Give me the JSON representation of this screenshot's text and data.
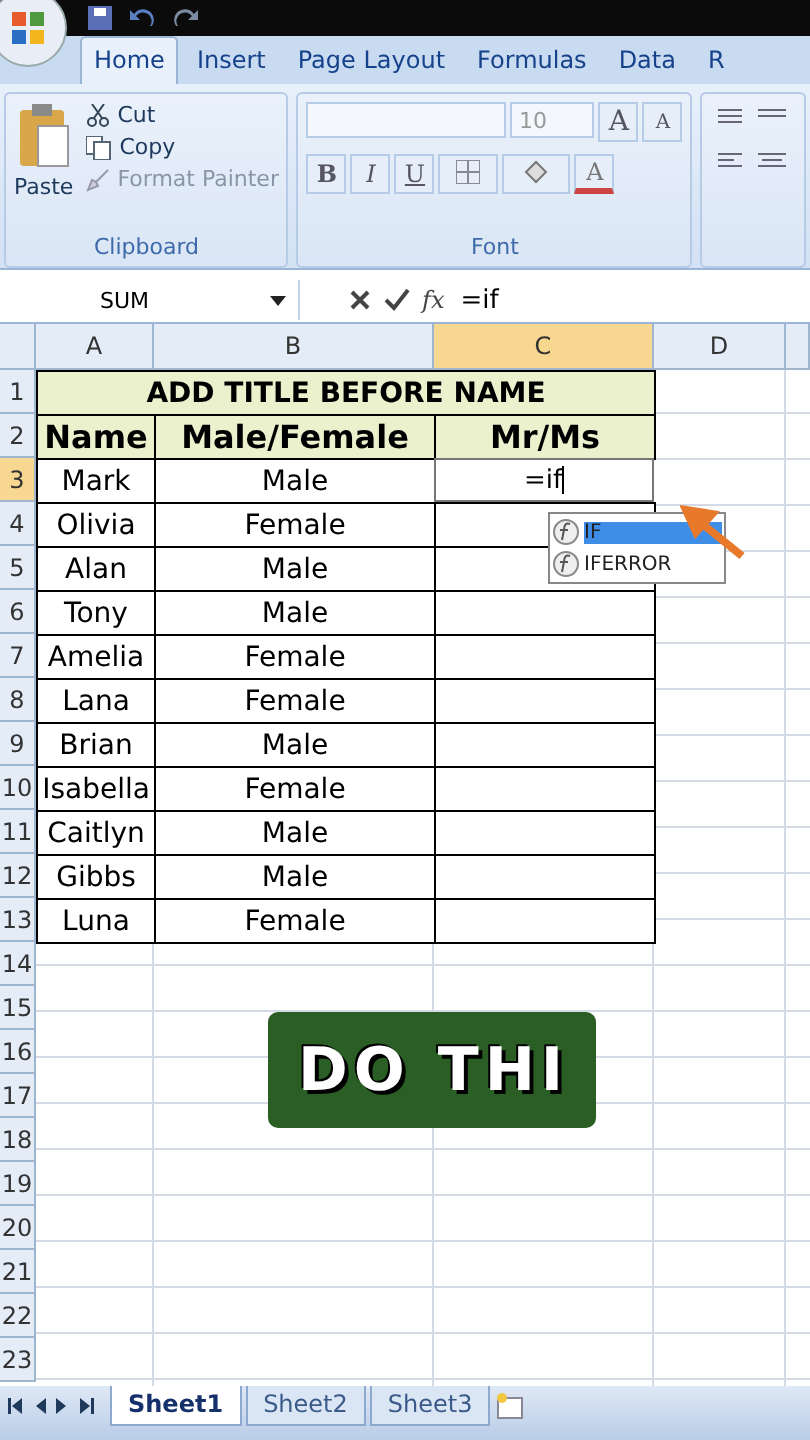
{
  "ribbon_tabs": [
    {
      "label": "Home",
      "selected": true
    },
    {
      "label": "Insert",
      "selected": false
    },
    {
      "label": "Page Layout",
      "selected": false
    },
    {
      "label": "Formulas",
      "selected": false
    },
    {
      "label": "Data",
      "selected": false
    },
    {
      "label": "R",
      "selected": false
    }
  ],
  "clipboard": {
    "paste": "Paste",
    "cut": "Cut",
    "copy": "Copy",
    "format_painter": "Format Painter",
    "group_label": "Clipboard"
  },
  "font": {
    "font_size": "10",
    "size_buttons": [
      "A",
      "A"
    ],
    "format_buttons": [
      "B",
      "I",
      "U"
    ],
    "font_color": "A",
    "group_label": "Font"
  },
  "formula_bar": {
    "name_box": "SUM",
    "function_label": "fx",
    "formula": "=if"
  },
  "columns": [
    {
      "label": "A",
      "selected": false
    },
    {
      "label": "B",
      "selected": false
    },
    {
      "label": "C",
      "selected": true
    },
    {
      "label": "D",
      "selected": false
    }
  ],
  "row_numbers": [
    {
      "label": "1",
      "selected": false
    },
    {
      "label": "2",
      "selected": false
    },
    {
      "label": "3",
      "selected": true
    },
    {
      "label": "4",
      "selected": false
    },
    {
      "label": "5",
      "selected": false
    },
    {
      "label": "6",
      "selected": false
    },
    {
      "label": "7",
      "selected": false
    },
    {
      "label": "8",
      "selected": false
    },
    {
      "label": "9",
      "selected": false
    },
    {
      "label": "10",
      "selected": false
    },
    {
      "label": "11",
      "selected": false
    },
    {
      "label": "12",
      "selected": false
    },
    {
      "label": "13",
      "selected": false
    },
    {
      "label": "14",
      "selected": false
    },
    {
      "label": "15",
      "selected": false
    },
    {
      "label": "16",
      "selected": false
    },
    {
      "label": "17",
      "selected": false
    },
    {
      "label": "18",
      "selected": false
    },
    {
      "label": "19",
      "selected": false
    },
    {
      "label": "20",
      "selected": false
    },
    {
      "label": "21",
      "selected": false
    },
    {
      "label": "22",
      "selected": false
    },
    {
      "label": "23",
      "selected": false
    }
  ],
  "table": {
    "title": "ADD TITLE BEFORE NAME",
    "headers": [
      "Name",
      "Male/Female",
      "Mr/Ms"
    ],
    "records": [
      {
        "name": "Mark",
        "gender": "Male",
        "title": "=if"
      },
      {
        "name": "Olivia",
        "gender": "Female"
      },
      {
        "name": "Alan",
        "gender": "Male"
      },
      {
        "name": "Tony",
        "gender": "Male"
      },
      {
        "name": "Amelia",
        "gender": "Female"
      },
      {
        "name": "Lana",
        "gender": "Female"
      },
      {
        "name": "Brian",
        "gender": "Male"
      },
      {
        "name": "Isabella",
        "gender": "Female"
      },
      {
        "name": "Caitlyn",
        "gender": "Male"
      },
      {
        "name": "Gibbs",
        "gender": "Male"
      },
      {
        "name": "Luna",
        "gender": "Female"
      }
    ]
  },
  "autocomplete": [
    {
      "label": "IF",
      "selected": true
    },
    {
      "label": "IFERROR",
      "selected": false
    }
  ],
  "caption": "DO THI",
  "sheet_tabs": [
    {
      "label": "Sheet1",
      "selected": true
    },
    {
      "label": "Sheet2",
      "selected": false
    },
    {
      "label": "Sheet3",
      "selected": false
    }
  ]
}
